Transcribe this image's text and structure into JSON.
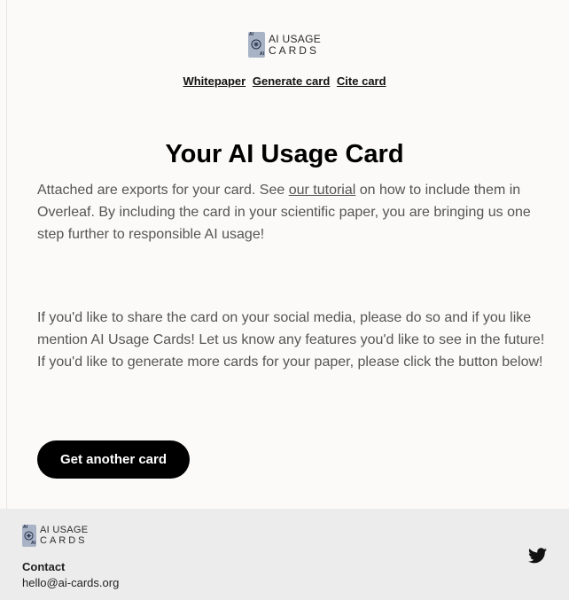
{
  "brand": {
    "line1": "AI USAGE",
    "line2": "CARDS",
    "badge": "AI"
  },
  "nav": {
    "whitepaper": "Whitepaper",
    "generate": "Generate card",
    "cite": "Cite card"
  },
  "main": {
    "title": "Your AI Usage Card",
    "p1_before": "Attached are exports for your card. See ",
    "p1_link": "our tutorial",
    "p1_after": " on how to include them in Overleaf. By including the card in your scientific paper, you are bringing us one step further to responsible AI usage!",
    "p2": "If you'd like to share the card on your social media, please do so and if you like mention AI Usage Cards! Let us know any features you'd like to see in the future! If you'd like to generate more cards for your paper, please click the button below!",
    "cta_label": "Get another card"
  },
  "footer": {
    "contact_label": "Contact",
    "email": "hello@ai-cards.org",
    "social_icon": "twitter-icon"
  },
  "colors": {
    "button_bg": "#000000",
    "footer_bg": "#ececec",
    "body_text": "#555555"
  }
}
